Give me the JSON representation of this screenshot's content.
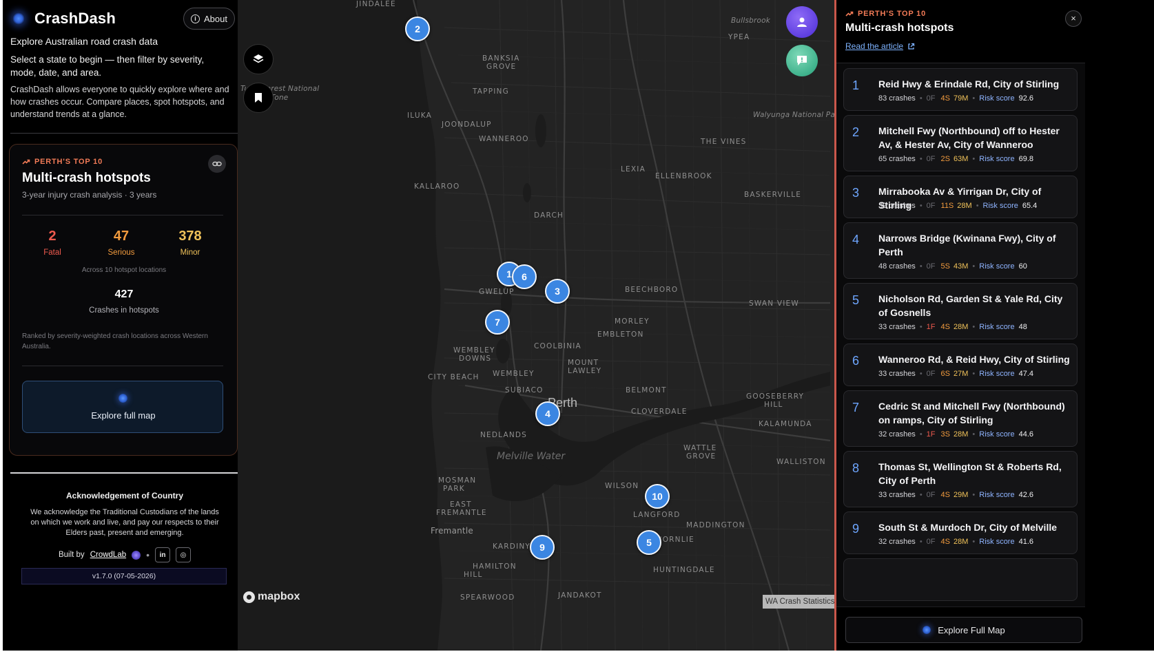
{
  "app": {
    "name": "CrashDash",
    "about_label": "About",
    "tagline": "Explore Australian road crash data",
    "intro": "Select a state to begin — then filter by severity, mode, date, and area.",
    "description": "CrashDash allows everyone to quickly explore where and how crashes occur. Compare places, spot hotspots, and understand trends at a glance."
  },
  "top10_card": {
    "kicker": "PERTH'S TOP 10",
    "title": "Multi-crash hotspots",
    "subtitle": "3-year injury crash analysis · 3 years",
    "stats": [
      {
        "value": "2",
        "label": "Fatal"
      },
      {
        "value": "47",
        "label": "Serious"
      },
      {
        "value": "378",
        "label": "Minor"
      }
    ],
    "across_note": "Across 10 hotspot locations",
    "total_crashes": "427",
    "total_label": "Crashes in hotspots",
    "ranked_note": "Ranked by severity-weighted crash locations across Western Australia.",
    "explore_label": "Explore full map"
  },
  "acknowledgement": {
    "title": "Acknowledgement of Country",
    "body": "We acknowledge the Traditional Custodians of the lands on which we work and live, and pay our respects to their Elders past, present and emerging."
  },
  "footer": {
    "built_by": "Built by",
    "org": "CrowdLab",
    "linkedin": "in",
    "instagram": "◎",
    "version": "v1.7.0 (07-05-2026)"
  },
  "map": {
    "labels": {
      "jindalee": "JINDALEE",
      "bullsbrook": "Bullsbrook",
      "ypea": "YPEA",
      "banksia": "BANKSIA",
      "banksia2": "GROVE",
      "tapping": "TAPPING",
      "iluka": "ILUKA",
      "joondalup": "JOONDALUP",
      "wanneroo": "WANNEROO",
      "walyunga": "Walyunga National Park",
      "thevines": "THE VINES",
      "lexia": "LEXIA",
      "ellenbrook": "ELLENBROOK",
      "kallaroo": "KALLAROO",
      "baskerville": "BASKERVILLE",
      "darch": "DARCH",
      "gwelup": "GWELUP",
      "beechboro": "BEECHBORO",
      "swanview": "SWAN VIEW",
      "morley": "MORLEY",
      "embleton": "EMBLETON",
      "coolbinia": "COOLBINIA",
      "wembleydowns1": "WEMBLEY",
      "wembleydowns2": "DOWNS",
      "mountlawley1": "MOUNT",
      "mountlawley2": "LAWLEY",
      "citybeach": "CITY BEACH",
      "wembley": "WEMBLEY",
      "subiaco": "SUBIACO",
      "perth": "Perth",
      "belmont": "BELMONT",
      "gooseberry1": "GOOSEBERRY",
      "gooseberry2": "HILL",
      "cloverdale": "CLOVERDALE",
      "kalamunda": "KALAMUNDA",
      "nedlands": "NEDLANDS",
      "wattle1": "WATTLE",
      "wattle2": "GROVE",
      "melville": "Melville Water",
      "walliston": "WALLISTON",
      "mosman1": "MOSMAN",
      "mosman2": "PARK",
      "wilson": "WILSON",
      "eastfre1": "EAST",
      "eastfre2": "FREMANTLE",
      "langford": "LANGFORD",
      "maddington": "MADDINGTON",
      "fremantle": "Fremantle",
      "kardinya": "KARDINYA",
      "thornlie": "THORNLIE",
      "hamilton1": "HAMILTON",
      "hamilton2": "HILL",
      "huntingdale": "HUNTINGDALE",
      "jandakot": "JANDAKOT",
      "spearwood": "SPEARWOOD",
      "tuart1": "Tuart Forest National",
      "tuart2": "Tone"
    },
    "mapbox_label": "mapbox",
    "attribution": "WA Crash Statistics"
  },
  "hotspots_panel": {
    "kicker": "PERTH'S TOP 10",
    "title": "Multi-crash hotspots",
    "read_article": "Read the article",
    "close_label": "×",
    "risk_label": "Risk score",
    "explore_label": "Explore Full Map",
    "items": [
      {
        "rank": "1",
        "name": "Reid Hwy & Erindale Rd, City of Stirling",
        "crashes": "83 crashes",
        "fatal": "0F",
        "serious": "4S",
        "minor": "79M",
        "risk": "92.6"
      },
      {
        "rank": "2",
        "name": "Mitchell Fwy (Northbound) off to Hester Av, & Hester Av, City of Wanneroo",
        "crashes": "65 crashes",
        "fatal": "0F",
        "serious": "2S",
        "minor": "63M",
        "risk": "69.8"
      },
      {
        "rank": "3",
        "name": "Mirrabooka Av & Yirrigan Dr, City of Stirling",
        "crashes": "39 crashes",
        "fatal": "0F",
        "serious": "11S",
        "minor": "28M",
        "risk": "65.4"
      },
      {
        "rank": "4",
        "name": "Narrows Bridge (Kwinana Fwy), City of Perth",
        "crashes": "48 crashes",
        "fatal": "0F",
        "serious": "5S",
        "minor": "43M",
        "risk": "60"
      },
      {
        "rank": "5",
        "name": "Nicholson Rd, Garden St & Yale Rd, City of Gosnells",
        "crashes": "33 crashes",
        "fatal": "1F",
        "serious": "4S",
        "minor": "28M",
        "risk": "48"
      },
      {
        "rank": "6",
        "name": "Wanneroo Rd, & Reid Hwy, City of Stirling",
        "crashes": "33 crashes",
        "fatal": "0F",
        "serious": "6S",
        "minor": "27M",
        "risk": "47.4"
      },
      {
        "rank": "7",
        "name": "Cedric St and Mitchell Fwy (Northbound) on ramps, City of Stirling",
        "crashes": "32 crashes",
        "fatal": "1F",
        "serious": "3S",
        "minor": "28M",
        "risk": "44.6"
      },
      {
        "rank": "8",
        "name": "Thomas St, Wellington St & Roberts Rd, City of Perth",
        "crashes": "33 crashes",
        "fatal": "0F",
        "serious": "4S",
        "minor": "29M",
        "risk": "42.6"
      },
      {
        "rank": "9",
        "name": "South St & Murdoch Dr, City of Melville",
        "crashes": "32 crashes",
        "fatal": "0F",
        "serious": "4S",
        "minor": "28M",
        "risk": "41.6"
      }
    ]
  },
  "markers": [
    "2",
    "1",
    "6",
    "3",
    "7",
    "4",
    "10",
    "9",
    "5"
  ]
}
